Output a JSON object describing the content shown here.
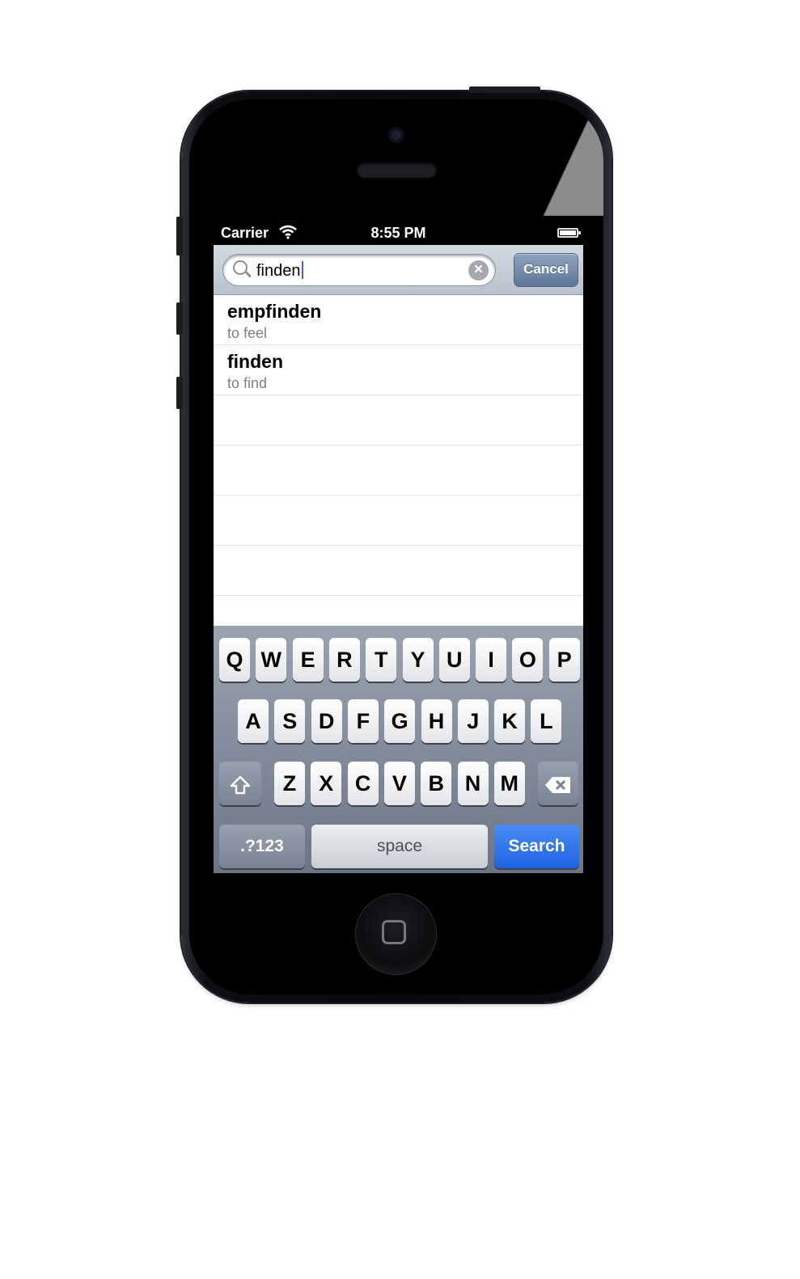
{
  "status": {
    "carrier": "Carrier",
    "time": "8:55 PM",
    "wifi_icon": "wifi-icon",
    "battery_level": 1.0
  },
  "search": {
    "value": "finden",
    "cancel_label": "Cancel"
  },
  "results": [
    {
      "word": "empfinden",
      "translation": "to feel"
    },
    {
      "word": "finden",
      "translation": "to find"
    }
  ],
  "keyboard": {
    "row1": [
      "Q",
      "W",
      "E",
      "R",
      "T",
      "Y",
      "U",
      "I",
      "O",
      "P"
    ],
    "row2": [
      "A",
      "S",
      "D",
      "F",
      "G",
      "H",
      "J",
      "K",
      "L"
    ],
    "row3": [
      "Z",
      "X",
      "C",
      "V",
      "B",
      "N",
      "M"
    ],
    "numbers_label": ".?123",
    "space_label": "space",
    "search_label": "Search",
    "shift_icon": "shift-icon",
    "delete_icon": "delete-icon"
  }
}
